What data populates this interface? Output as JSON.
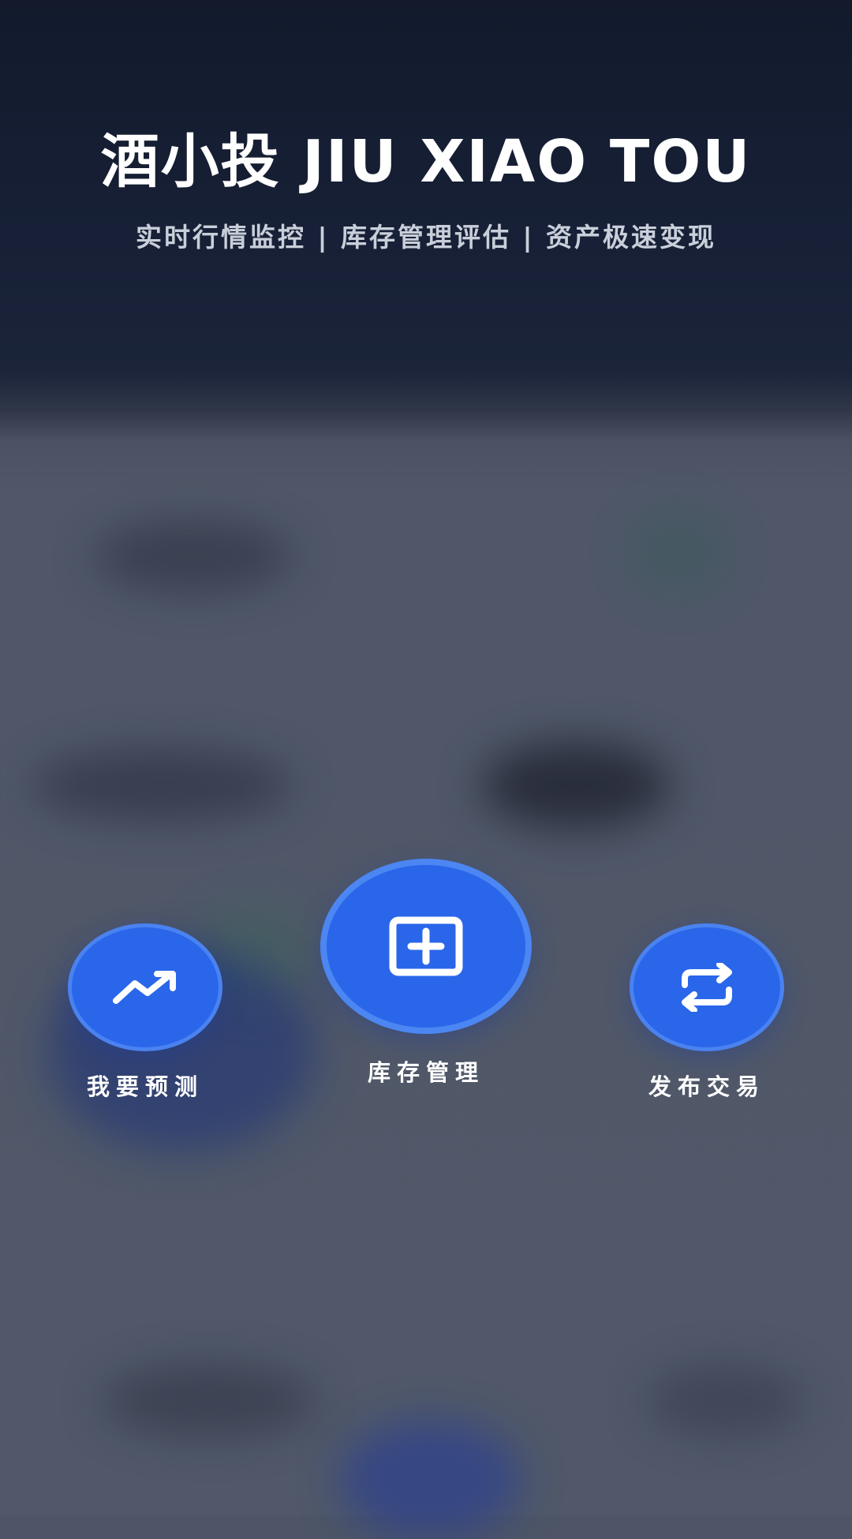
{
  "header": {
    "title": "酒小投 JIU XIAO TOU",
    "subtitle": "实时行情监控 | 库存管理评估 | 资产极速变现"
  },
  "actions": {
    "predict": {
      "label": "我要预测",
      "icon": "trending-up-icon"
    },
    "inventory": {
      "label": "库存管理",
      "icon": "plus-square-icon"
    },
    "trade": {
      "label": "发布交易",
      "icon": "repeat-icon"
    }
  },
  "colors": {
    "header_bg": "#121a2c",
    "overlay_bg": "#505869",
    "accent": "#2a66ea",
    "accent_border": "#4a82f0"
  }
}
